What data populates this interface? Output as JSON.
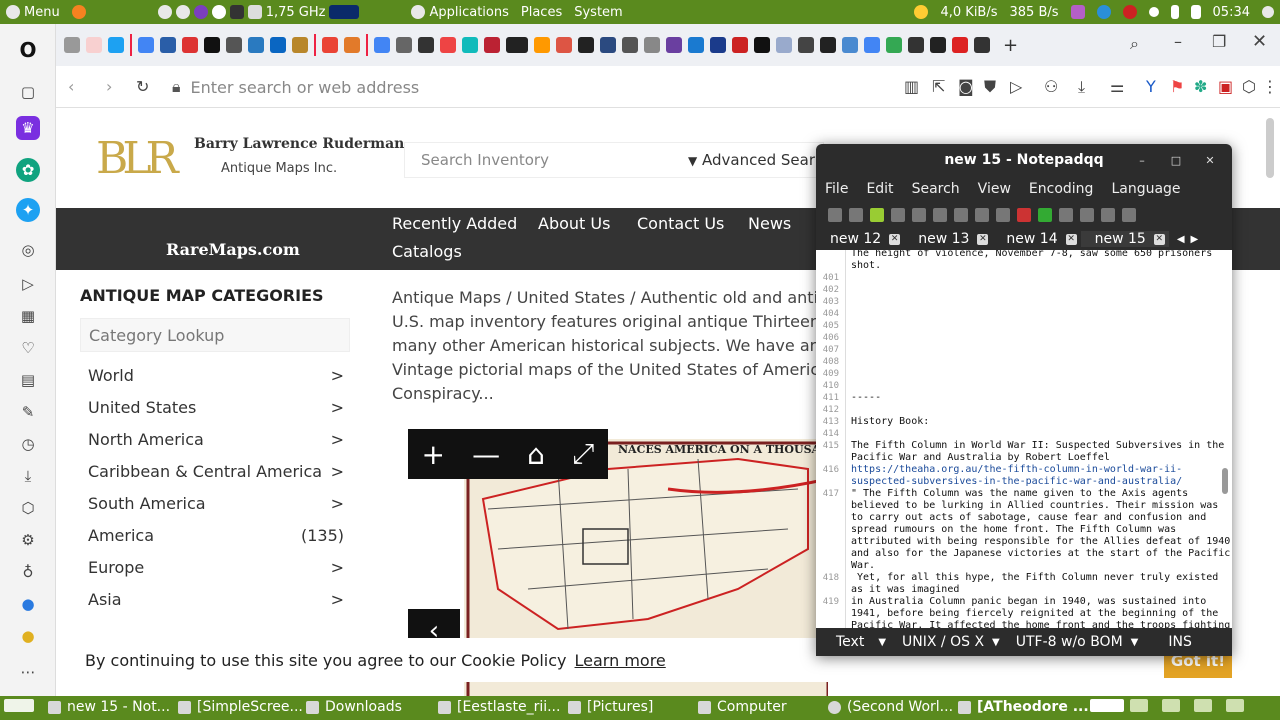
{
  "topbar": {
    "menu": "Menu",
    "cpu": "1,75 GHz",
    "applications": "Applications",
    "places": "Places",
    "system": "System",
    "net_down": "4,0 KiB/s",
    "net_up": "385 B/s",
    "time": "05:34"
  },
  "browser": {
    "url_placeholder": "Enter search or web address"
  },
  "site": {
    "brand_name": "Barry Lawrence Ruderman",
    "brand_sub": "Antique Maps Inc.",
    "logo": "BLR",
    "search_placeholder": "Search Inventory",
    "advanced_search": "Advanced Sear",
    "raremaps": "RareMaps.com",
    "nav": [
      "Recently Added",
      "About Us",
      "Contact Us",
      "News",
      "Catalogs"
    ],
    "categories_title": "ANTIQUE MAP CATEGORIES",
    "category_lookup": "Category Lookup",
    "categories": [
      {
        "name": "World",
        "count": ">"
      },
      {
        "name": "United States",
        "count": ">"
      },
      {
        "name": "North America",
        "count": ">"
      },
      {
        "name": "Caribbean & Central America",
        "count": ">"
      },
      {
        "name": "South America",
        "count": ">"
      },
      {
        "name": "America",
        "count": "(135)"
      },
      {
        "name": "Europe",
        "count": ">"
      },
      {
        "name": "Asia",
        "count": ">"
      }
    ],
    "breadcrumb_lines": [
      "Antique Maps  /  United States  /  Authentic old and antiq",
      "U.S. map inventory features original antique Thirteen Colon",
      "many other American historical subjects. We have antique r",
      "Vintage pictorial maps of the United States of America are a",
      "Conspiracy..."
    ],
    "map_caption": "NACES AMERICA ON A THOUSAND F",
    "cookie_text": "By continuing to use this site you agree to our Cookie Policy",
    "learn_more": "Learn more",
    "got_it": "Got it!"
  },
  "notepad": {
    "title": "new 15 - Notepadqq",
    "menu": [
      "File",
      "Edit",
      "Search",
      "View",
      "Encoding",
      "Language"
    ],
    "tabs": [
      "new 12",
      "new 13",
      "new 14",
      "new 15"
    ],
    "lines": [
      {
        "n": "",
        "t": "The height of violence, November 7-8, saw some 650 prisoners"
      },
      {
        "n": "",
        "t": "shot."
      },
      {
        "n": "401",
        "t": ""
      },
      {
        "n": "402",
        "t": ""
      },
      {
        "n": "403",
        "t": ""
      },
      {
        "n": "404",
        "t": ""
      },
      {
        "n": "405",
        "t": ""
      },
      {
        "n": "406",
        "t": ""
      },
      {
        "n": "407",
        "t": ""
      },
      {
        "n": "408",
        "t": ""
      },
      {
        "n": "409",
        "t": ""
      },
      {
        "n": "410",
        "t": ""
      },
      {
        "n": "411",
        "t": "-----"
      },
      {
        "n": "412",
        "t": ""
      },
      {
        "n": "413",
        "t": "History Book:"
      },
      {
        "n": "414",
        "t": ""
      },
      {
        "n": "415",
        "t": "The Fifth Column in World War II: Suspected Subversives in the"
      },
      {
        "n": "",
        "t": "Pacific War and Australia by Robert Loeffel"
      },
      {
        "n": "416",
        "t": "https://theaha.org.au/the-fifth-column-in-world-war-ii-"
      },
      {
        "n": "",
        "t": "suspected-subversives-in-the-pacific-war-and-australia/"
      },
      {
        "n": "417",
        "t": "\" The Fifth Column was the name given to the Axis agents"
      },
      {
        "n": "",
        "t": "believed to be lurking in Allied countries. Their mission was"
      },
      {
        "n": "",
        "t": "to carry out acts of sabotage, cause fear and confusion and"
      },
      {
        "n": "",
        "t": "spread rumours on the home front. The Fifth Column was"
      },
      {
        "n": "",
        "t": "attributed with being responsible for the Allies defeat of 1940"
      },
      {
        "n": "",
        "t": "and also for the Japanese victories at the start of the Pacific"
      },
      {
        "n": "",
        "t": "War."
      },
      {
        "n": "418",
        "t": " Yet, for all this hype, the Fifth Column never truly existed"
      },
      {
        "n": "",
        "t": "as it was imagined"
      },
      {
        "n": "419",
        "t": "in Australia Column panic began in 1940, was sustained into"
      },
      {
        "n": "",
        "t": "1941, before being fiercely reignited at the beginning of the"
      },
      {
        "n": "",
        "t": "Pacific War. It affected the home front and the troops fighting"
      }
    ],
    "status": {
      "lang": "Text",
      "eol": "UNIX / OS X",
      "enc": "UTF-8 w/o BOM",
      "mode": "INS"
    }
  },
  "taskbar": [
    "new 15 - Not...",
    "[SimpleScree...",
    "Downloads",
    "[Eestlaste_rii...",
    "[Pictures]",
    "Computer",
    "(Second Worl...",
    "[ATheodore ..."
  ]
}
